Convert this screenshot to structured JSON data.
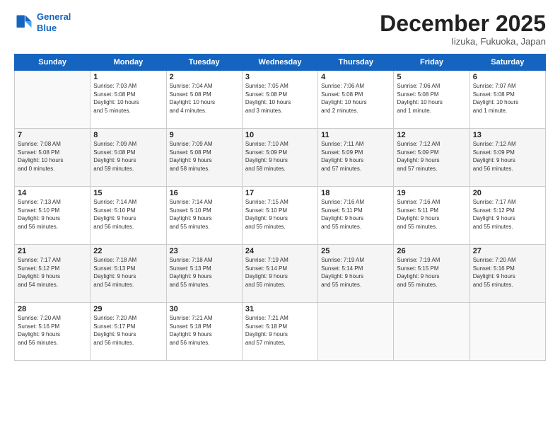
{
  "header": {
    "logo_line1": "General",
    "logo_line2": "Blue",
    "month": "December 2025",
    "location": "Iizuka, Fukuoka, Japan"
  },
  "days_of_week": [
    "Sunday",
    "Monday",
    "Tuesday",
    "Wednesday",
    "Thursday",
    "Friday",
    "Saturday"
  ],
  "weeks": [
    [
      {
        "day": "",
        "info": ""
      },
      {
        "day": "1",
        "info": "Sunrise: 7:03 AM\nSunset: 5:08 PM\nDaylight: 10 hours\nand 5 minutes."
      },
      {
        "day": "2",
        "info": "Sunrise: 7:04 AM\nSunset: 5:08 PM\nDaylight: 10 hours\nand 4 minutes."
      },
      {
        "day": "3",
        "info": "Sunrise: 7:05 AM\nSunset: 5:08 PM\nDaylight: 10 hours\nand 3 minutes."
      },
      {
        "day": "4",
        "info": "Sunrise: 7:06 AM\nSunset: 5:08 PM\nDaylight: 10 hours\nand 2 minutes."
      },
      {
        "day": "5",
        "info": "Sunrise: 7:06 AM\nSunset: 5:08 PM\nDaylight: 10 hours\nand 1 minute."
      },
      {
        "day": "6",
        "info": "Sunrise: 7:07 AM\nSunset: 5:08 PM\nDaylight: 10 hours\nand 1 minute."
      }
    ],
    [
      {
        "day": "7",
        "info": "Sunrise: 7:08 AM\nSunset: 5:08 PM\nDaylight: 10 hours\nand 0 minutes."
      },
      {
        "day": "8",
        "info": "Sunrise: 7:09 AM\nSunset: 5:08 PM\nDaylight: 9 hours\nand 59 minutes."
      },
      {
        "day": "9",
        "info": "Sunrise: 7:09 AM\nSunset: 5:08 PM\nDaylight: 9 hours\nand 58 minutes."
      },
      {
        "day": "10",
        "info": "Sunrise: 7:10 AM\nSunset: 5:09 PM\nDaylight: 9 hours\nand 58 minutes."
      },
      {
        "day": "11",
        "info": "Sunrise: 7:11 AM\nSunset: 5:09 PM\nDaylight: 9 hours\nand 57 minutes."
      },
      {
        "day": "12",
        "info": "Sunrise: 7:12 AM\nSunset: 5:09 PM\nDaylight: 9 hours\nand 57 minutes."
      },
      {
        "day": "13",
        "info": "Sunrise: 7:12 AM\nSunset: 5:09 PM\nDaylight: 9 hours\nand 56 minutes."
      }
    ],
    [
      {
        "day": "14",
        "info": "Sunrise: 7:13 AM\nSunset: 5:10 PM\nDaylight: 9 hours\nand 56 minutes."
      },
      {
        "day": "15",
        "info": "Sunrise: 7:14 AM\nSunset: 5:10 PM\nDaylight: 9 hours\nand 56 minutes."
      },
      {
        "day": "16",
        "info": "Sunrise: 7:14 AM\nSunset: 5:10 PM\nDaylight: 9 hours\nand 55 minutes."
      },
      {
        "day": "17",
        "info": "Sunrise: 7:15 AM\nSunset: 5:10 PM\nDaylight: 9 hours\nand 55 minutes."
      },
      {
        "day": "18",
        "info": "Sunrise: 7:16 AM\nSunset: 5:11 PM\nDaylight: 9 hours\nand 55 minutes."
      },
      {
        "day": "19",
        "info": "Sunrise: 7:16 AM\nSunset: 5:11 PM\nDaylight: 9 hours\nand 55 minutes."
      },
      {
        "day": "20",
        "info": "Sunrise: 7:17 AM\nSunset: 5:12 PM\nDaylight: 9 hours\nand 55 minutes."
      }
    ],
    [
      {
        "day": "21",
        "info": "Sunrise: 7:17 AM\nSunset: 5:12 PM\nDaylight: 9 hours\nand 54 minutes."
      },
      {
        "day": "22",
        "info": "Sunrise: 7:18 AM\nSunset: 5:13 PM\nDaylight: 9 hours\nand 54 minutes."
      },
      {
        "day": "23",
        "info": "Sunrise: 7:18 AM\nSunset: 5:13 PM\nDaylight: 9 hours\nand 55 minutes."
      },
      {
        "day": "24",
        "info": "Sunrise: 7:19 AM\nSunset: 5:14 PM\nDaylight: 9 hours\nand 55 minutes."
      },
      {
        "day": "25",
        "info": "Sunrise: 7:19 AM\nSunset: 5:14 PM\nDaylight: 9 hours\nand 55 minutes."
      },
      {
        "day": "26",
        "info": "Sunrise: 7:19 AM\nSunset: 5:15 PM\nDaylight: 9 hours\nand 55 minutes."
      },
      {
        "day": "27",
        "info": "Sunrise: 7:20 AM\nSunset: 5:16 PM\nDaylight: 9 hours\nand 55 minutes."
      }
    ],
    [
      {
        "day": "28",
        "info": "Sunrise: 7:20 AM\nSunset: 5:16 PM\nDaylight: 9 hours\nand 56 minutes."
      },
      {
        "day": "29",
        "info": "Sunrise: 7:20 AM\nSunset: 5:17 PM\nDaylight: 9 hours\nand 56 minutes."
      },
      {
        "day": "30",
        "info": "Sunrise: 7:21 AM\nSunset: 5:18 PM\nDaylight: 9 hours\nand 56 minutes."
      },
      {
        "day": "31",
        "info": "Sunrise: 7:21 AM\nSunset: 5:18 PM\nDaylight: 9 hours\nand 57 minutes."
      },
      {
        "day": "",
        "info": ""
      },
      {
        "day": "",
        "info": ""
      },
      {
        "day": "",
        "info": ""
      }
    ]
  ]
}
